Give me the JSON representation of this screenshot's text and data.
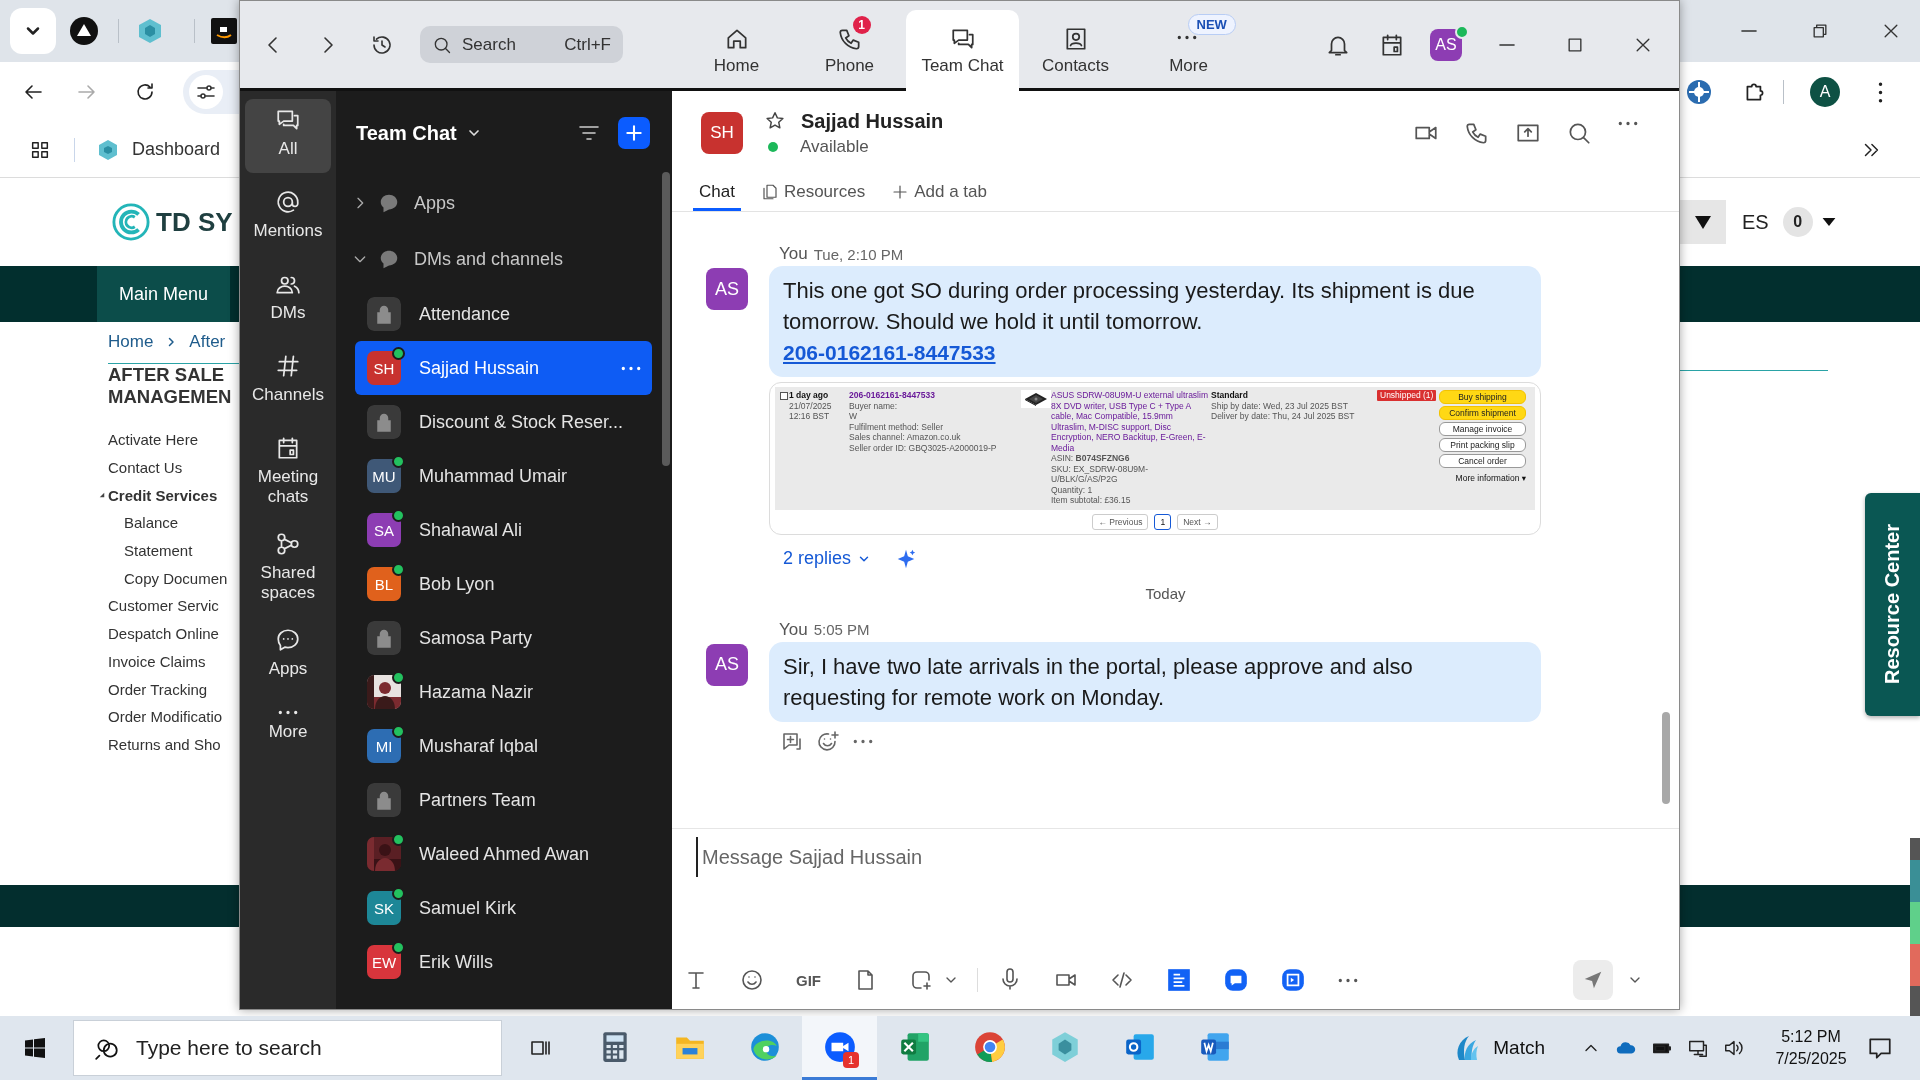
{
  "browser": {
    "bookmark": "Dashboard",
    "profile_initial": "A",
    "logo_text": "TD SY",
    "language": "ES",
    "cart_count": "0",
    "nav_item": "Main Menu",
    "breadcrumb": [
      "Home",
      "After"
    ],
    "heading": [
      "AFTER SALE",
      "MANAGEMEN"
    ],
    "menu": [
      {
        "label": "Activate Here"
      },
      {
        "label": "Contact Us"
      },
      {
        "label": "Credit Services",
        "expanded": true,
        "children": [
          {
            "label": "Balance"
          },
          {
            "label": "Statement"
          },
          {
            "label": "Copy Documen"
          }
        ]
      },
      {
        "label": "Customer Servic"
      },
      {
        "label": "Despatch Online"
      },
      {
        "label": "Invoice Claims"
      },
      {
        "label": "Order Tracking"
      },
      {
        "label": "Order Modificatio"
      },
      {
        "label": "Returns and Sho"
      }
    ],
    "resource_center": "Resource Center"
  },
  "zoom": {
    "nav": {
      "search": {
        "placeholder": "Search",
        "shortcut": "Ctrl+F"
      },
      "tabs": [
        {
          "kind": "home",
          "label": "Home",
          "selected": false
        },
        {
          "kind": "phone",
          "label": "Phone",
          "selected": false,
          "count": "1"
        },
        {
          "kind": "chat",
          "label": "Team Chat",
          "selected": true
        },
        {
          "kind": "contacts",
          "label": "Contacts",
          "selected": false
        },
        {
          "kind": "more",
          "label": "More",
          "selected": false,
          "tag": "NEW"
        }
      ],
      "user": {
        "initials": "AS",
        "online": true
      }
    },
    "rail": [
      {
        "kind": "chat",
        "label": "All",
        "selected": true
      },
      {
        "kind": "mentions",
        "label": "Mentions",
        "selected": false
      },
      {
        "kind": "dms",
        "label": "DMs",
        "selected": false
      },
      {
        "kind": "channels",
        "label": "Channels",
        "selected": false
      },
      {
        "kind": "meetings",
        "label": "Meeting chats",
        "selected": false
      },
      {
        "kind": "shared",
        "label": "Shared spaces",
        "selected": false
      },
      {
        "kind": "apps",
        "label": "Apps",
        "selected": false
      },
      {
        "kind": "more",
        "label": "More",
        "selected": false
      }
    ],
    "sidebar": {
      "title": "Team Chat",
      "sections": [
        {
          "label": "Apps",
          "expanded": false
        },
        {
          "label": "DMs and channels",
          "expanded": true,
          "items": [
            {
              "kind": "channel",
              "name": "Attendance",
              "selected": false
            },
            {
              "kind": "person",
              "name": "Sajjad Hussain",
              "initials": "SH",
              "color": "#c8322f",
              "online": true,
              "selected": true
            },
            {
              "kind": "channel",
              "name": "Discount & Stock Reser...",
              "selected": false
            },
            {
              "kind": "person",
              "name": "Muhammad Umair",
              "initials": "MU",
              "color": "#3f5877",
              "online": true,
              "selected": false
            },
            {
              "kind": "person",
              "name": "Shahawal Ali",
              "initials": "SA",
              "color": "#8d3db3",
              "online": true,
              "selected": false
            },
            {
              "kind": "person",
              "name": "Bob Lyon",
              "initials": "BL",
              "color": "#e0611c",
              "online": true,
              "selected": false
            },
            {
              "kind": "channel",
              "name": "Samosa Party",
              "selected": false
            },
            {
              "name": "Hazama Nazir",
              "online": true,
              "selected": false
            },
            {
              "kind": "person",
              "name": "Musharaf Iqbal",
              "initials": "MI",
              "color": "#2d6db3",
              "online": true,
              "selected": false
            },
            {
              "kind": "channel",
              "name": "Partners Team",
              "selected": false
            },
            {
              "name": "Waleed Ahmed Awan",
              "online": true,
              "selected": false
            },
            {
              "kind": "person",
              "name": "Samuel Kirk",
              "initials": "SK",
              "color": "#1d8797",
              "online": true,
              "selected": false
            },
            {
              "kind": "person",
              "name": "Erik Wills",
              "initials": "EW",
              "color": "#d8353c",
              "online": true,
              "selected": false
            }
          ]
        }
      ]
    },
    "conversation": {
      "name": "Sajjad Hussain",
      "initials": "SH",
      "status": "Available",
      "online": true,
      "starred": false,
      "tabs": [
        {
          "kind": "chat",
          "label": "Chat",
          "selected": true
        },
        {
          "kind": "resources",
          "label": "Resources",
          "selected": false
        },
        {
          "kind": "add",
          "label": "Add a tab",
          "selected": false
        }
      ],
      "messages": [
        {
          "kind": "message",
          "sender": "You",
          "time": "Tue, 2:10 PM",
          "initials": "AS",
          "text": "This one got SO during order processing yesterday. Its shipment is due tomorrow. Should we hold it until tomorrow.",
          "link": "206-0162161-8447533",
          "replies": "2 replies",
          "attachment": {
            "checked": false,
            "age": "1 day ago",
            "date": "21/07/2025",
            "time": "12:16 BST",
            "order_id": "206-0162161-8447533",
            "order_lines": [
              "Buyer name:",
              "W",
              "Fulfilment method: Seller",
              "Sales channel: Amazon.co.uk",
              "Seller order ID: GBQ3025-A2000019-P"
            ],
            "product": "ASUS SDRW-08U9M-U external ultraslim 8X DVD writer, USB Type C + Type A cable, Mac Compatible, 15.9mm Ultraslim, M-DISC support, Disc Encryption, NERO Backitup, E-Green, E-Media",
            "product_lines": [
              "ASIN: **B074SFZNG6**",
              "SKU: EX_SDRW-08U9M-U/BLK/G/AS/P2G",
              "Quantity: 1",
              "Item subtotal: £36.15"
            ],
            "shipping": "Standard",
            "shipping_lines": [
              "Ship by date: Wed, 23 Jul 2025 BST",
              "Deliver by date: Thu, 24 Jul 2025 BST"
            ],
            "status": "Unshipped (1)",
            "actions": [
              {
                "label": "Buy shipping",
                "primary": true
              },
              {
                "label": "Confirm shipment",
                "primary": true
              },
              {
                "label": "Manage invoice",
                "primary": false
              },
              {
                "label": "Print packing slip",
                "primary": false
              },
              {
                "label": "Cancel order",
                "primary": false
              }
            ],
            "more": "More information ▾",
            "pagination": {
              "previous": "← Previous",
              "page": "1",
              "next": "Next →"
            }
          }
        },
        {
          "kind": "divider",
          "label": "Today"
        },
        {
          "kind": "message",
          "sender": "You",
          "time": "5:05 PM",
          "initials": "AS",
          "text": "Sir, I have two late arrivals in the portal, please approve and also requesting for remote work on Monday.",
          "actions": [
            {
              "kind": "reply"
            },
            {
              "kind": "react"
            },
            {
              "kind": "more"
            }
          ]
        }
      ],
      "composer": {
        "placeholder": "Message Sajjad Hussain",
        "gif": "GIF"
      }
    }
  },
  "taskbar": {
    "search_placeholder": "Type here to search",
    "apps": [
      {
        "kind": "calculator",
        "active": false
      },
      {
        "kind": "files",
        "active": false
      },
      {
        "kind": "edge",
        "active": false
      },
      {
        "kind": "zoom",
        "active": true,
        "count": "1"
      },
      {
        "kind": "excel",
        "active": false
      },
      {
        "kind": "chrome",
        "active": false
      },
      {
        "kind": "hexagon",
        "active": false
      },
      {
        "kind": "outlook",
        "active": false
      },
      {
        "kind": "word",
        "active": false
      }
    ],
    "widget": "Match",
    "time": "5:12 PM",
    "date": "7/25/2025"
  }
}
